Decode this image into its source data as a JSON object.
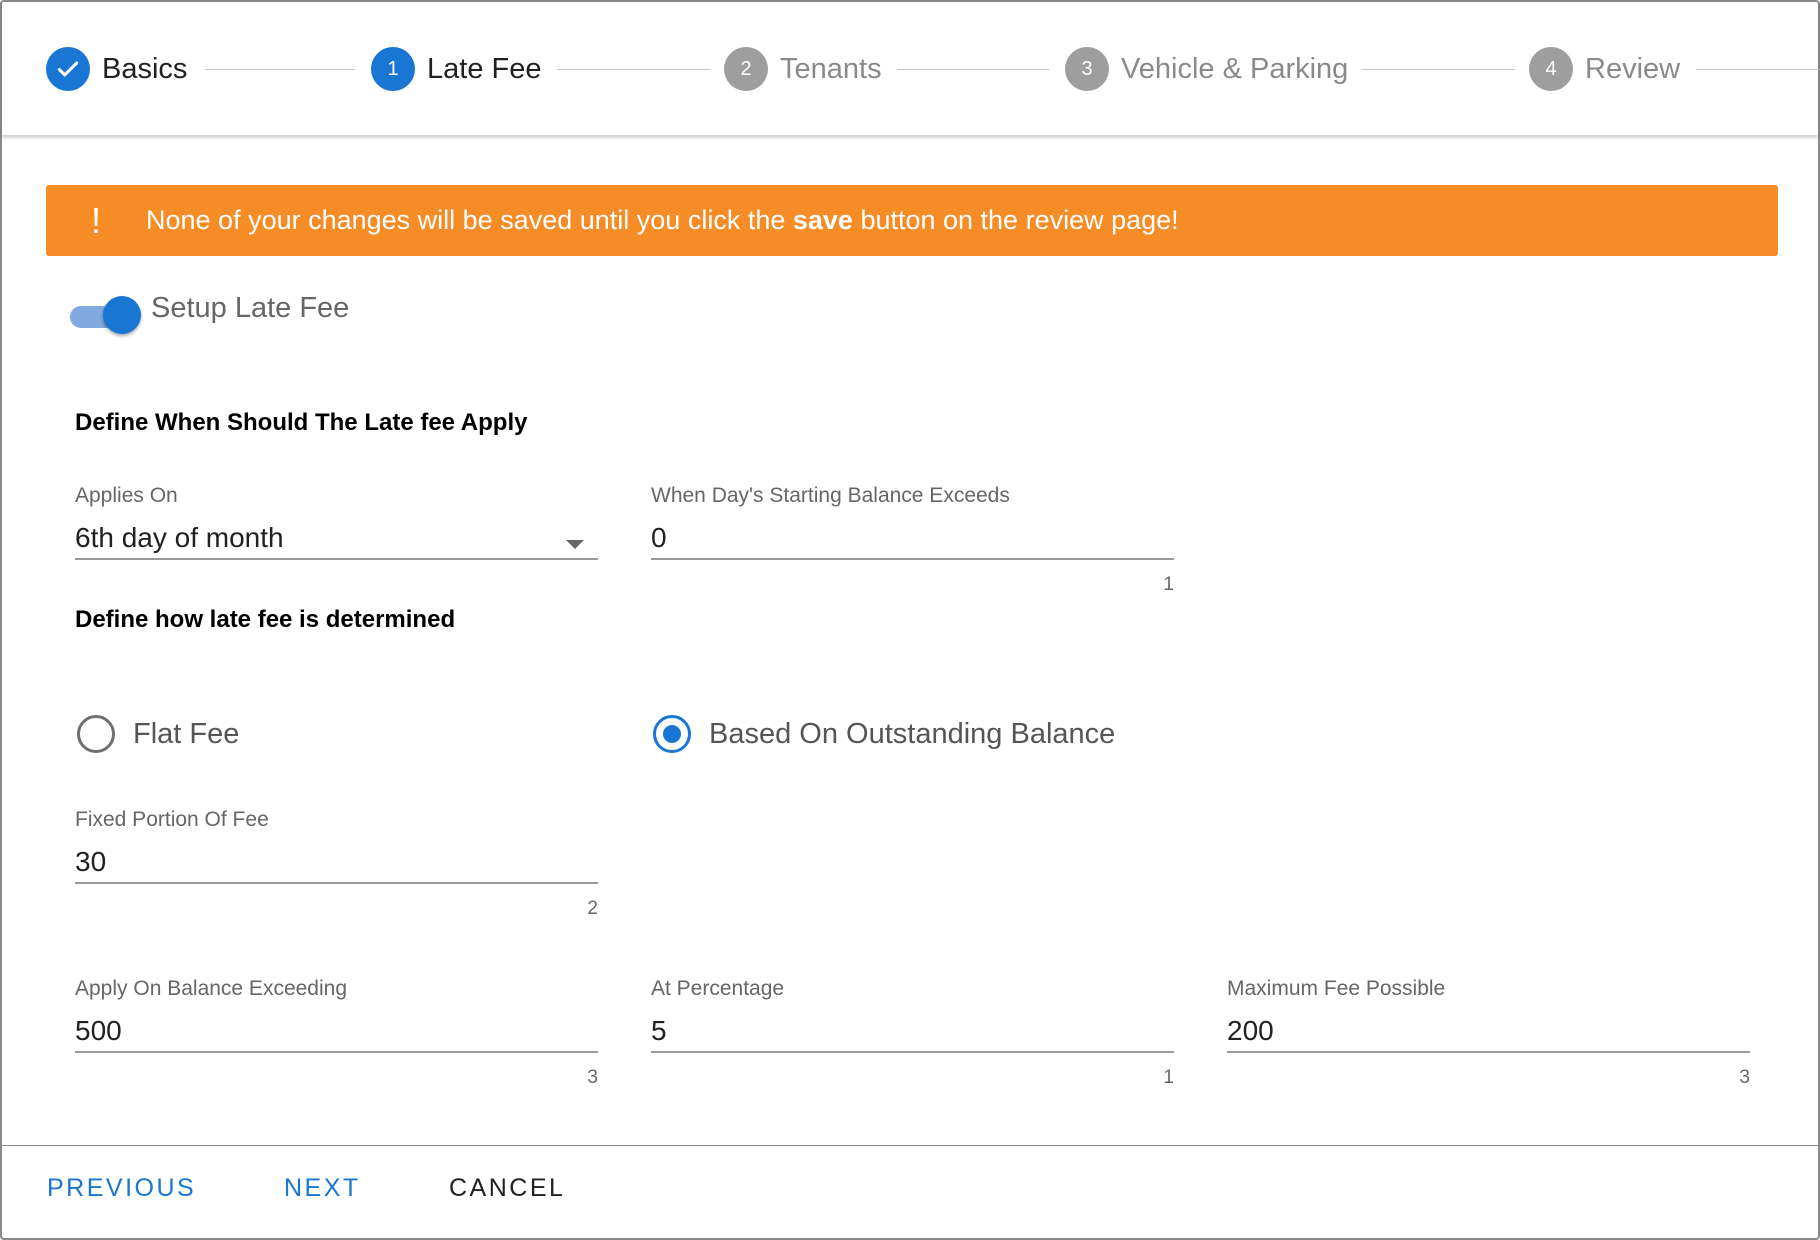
{
  "stepper": {
    "steps": [
      {
        "label": "Basics",
        "marker": "✓",
        "state": "done"
      },
      {
        "label": "Late Fee",
        "marker": "1",
        "state": "active"
      },
      {
        "label": "Tenants",
        "marker": "2",
        "state": "todo"
      },
      {
        "label": "Vehicle & Parking",
        "marker": "3",
        "state": "todo"
      },
      {
        "label": "Review",
        "marker": "4",
        "state": "todo"
      }
    ]
  },
  "banner": {
    "icon": "!",
    "text_before": "None of your changes will be saved until you click the ",
    "text_bold": "save",
    "text_after": " button on the review page!",
    "color": "#f68c25"
  },
  "toggle": {
    "label": "Setup Late Fee",
    "on": true
  },
  "section_when": {
    "title": "Define When Should The Late fee Apply"
  },
  "applies_on": {
    "label": "Applies On",
    "value": "6th day of month"
  },
  "balance_exceeds": {
    "label": "When Day's Starting Balance Exceeds",
    "value": "0",
    "counter": "1"
  },
  "section_how": {
    "title": "Define how late fee is determined"
  },
  "fee_type": {
    "options": [
      {
        "label": "Flat Fee",
        "checked": false
      },
      {
        "label": "Based On Outstanding Balance",
        "checked": true
      }
    ]
  },
  "fixed_portion": {
    "label": "Fixed Portion Of Fee",
    "value": "30",
    "counter": "2"
  },
  "apply_on_balance": {
    "label": "Apply On Balance Exceeding",
    "value": "500",
    "counter": "3"
  },
  "at_percentage": {
    "label": "At Percentage",
    "value": "5",
    "counter": "1"
  },
  "max_fee": {
    "label": "Maximum Fee Possible",
    "value": "200",
    "counter": "3"
  },
  "footer": {
    "previous": "PREVIOUS",
    "next": "NEXT",
    "cancel": "CANCEL"
  },
  "colors": {
    "accent": "#1976d2",
    "inactive": "#9e9e9e"
  }
}
